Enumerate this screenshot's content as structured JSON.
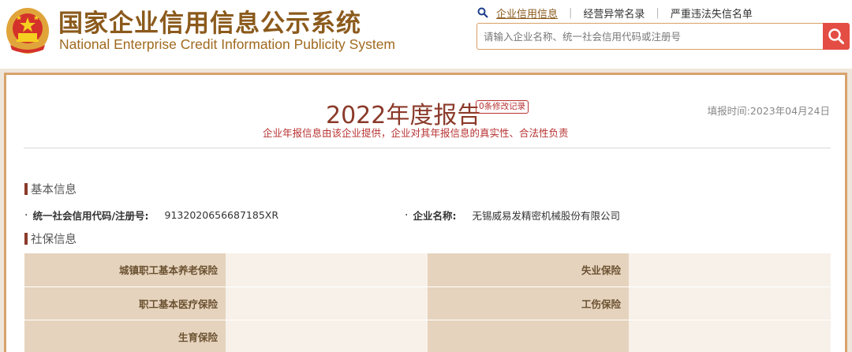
{
  "header": {
    "title_cn": "国家企业信用信息公示系统",
    "title_en": "National Enterprise Credit Information Publicity System",
    "nav": [
      {
        "label": "企业信用信息",
        "active": true
      },
      {
        "label": "经营异常名录",
        "active": false
      },
      {
        "label": "严重违法失信名单",
        "active": false
      }
    ],
    "search_placeholder": "请输入企业名称、统一社会信用代码或注册号"
  },
  "report": {
    "title": "2022年度报告",
    "edit_badge": "0条修改记录",
    "fill_time": "填报时间:2023年04月24日",
    "note": "企业年报信息由该企业提供，企业对其年报信息的真实性、合法性负责"
  },
  "basic_info": {
    "section_title": "基本信息",
    "credit_code_label": "统一社会信用代码/注册号:",
    "credit_code_value": "9132020656687185XR",
    "company_name_label": "企业名称:",
    "company_name_value": "无锡威易发精密机械股份有限公司"
  },
  "social_security": {
    "section_title": "社保信息",
    "rows": [
      [
        {
          "key": "城镇职工基本养老保险",
          "value": ""
        },
        {
          "key": "失业保险",
          "value": ""
        }
      ],
      [
        {
          "key": "职工基本医疗保险",
          "value": ""
        },
        {
          "key": "工伤保险",
          "value": ""
        }
      ],
      [
        {
          "key": "生育保险",
          "value": ""
        },
        {
          "key": "",
          "value": ""
        }
      ]
    ]
  },
  "colors": {
    "brand_brown": "#8b5a1c",
    "accent_red": "#b83232",
    "frame_border": "#d7a26b",
    "search_button": "#e44d44",
    "table_key_bg": "#e6d3bd",
    "table_value_bg": "#f7f1ea"
  },
  "icons": {
    "emblem": "national-emblem",
    "nav_search": "search-icon",
    "search_button": "search-icon"
  }
}
